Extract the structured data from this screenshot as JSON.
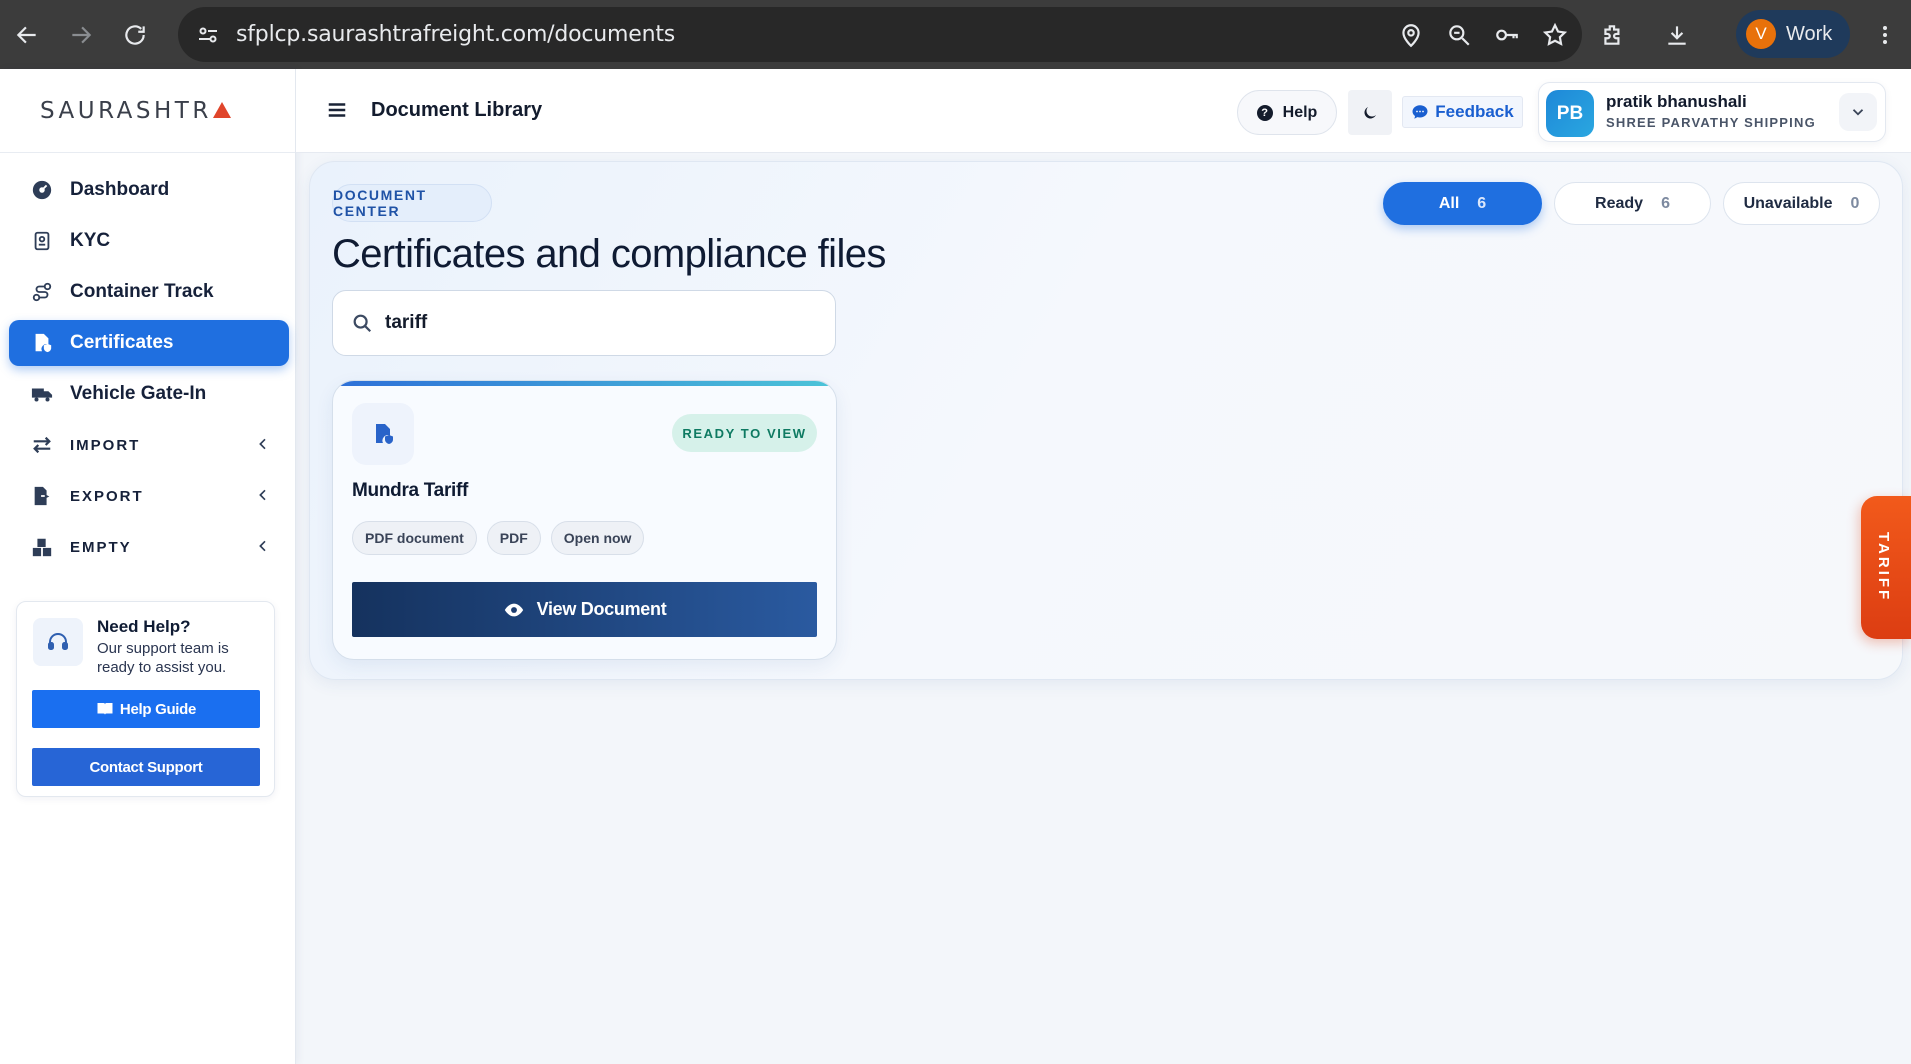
{
  "browser": {
    "url": "sfplcp.saurashtrafreight.com/documents",
    "profile_initial": "V",
    "profile_label": "Work"
  },
  "sidebar": {
    "brand": "SAURASHTR",
    "items": [
      {
        "label": "Dashboard",
        "icon": "dashboard-icon"
      },
      {
        "label": "KYC",
        "icon": "kyc-icon"
      },
      {
        "label": "Container Track",
        "icon": "route-icon"
      },
      {
        "label": "Certificates",
        "icon": "certificate-icon",
        "active": true
      },
      {
        "label": "Vehicle Gate-In",
        "icon": "truck-icon"
      }
    ],
    "sections": [
      {
        "label": "IMPORT",
        "icon": "swap-icon"
      },
      {
        "label": "EXPORT",
        "icon": "export-icon"
      },
      {
        "label": "EMPTY",
        "icon": "boxes-icon"
      }
    ],
    "help": {
      "title": "Need Help?",
      "subtitle": "Our support team is ready to assist you.",
      "guide_label": "Help Guide",
      "support_label": "Contact Support"
    }
  },
  "header": {
    "title": "Document Library",
    "help_label": "Help",
    "feedback_label": "Feedback",
    "user": {
      "initials": "PB",
      "name": "pratik bhanushali",
      "company": "SHREE PARVATHY SHIPPING"
    }
  },
  "main": {
    "eyebrow": "DOCUMENT CENTER",
    "heading": "Certificates and compliance files",
    "search_value": "tariff",
    "filters": [
      {
        "label": "All",
        "count": "6",
        "active": true
      },
      {
        "label": "Ready",
        "count": "6"
      },
      {
        "label": "Unavailable",
        "count": "0"
      }
    ],
    "card": {
      "status": "READY TO VIEW",
      "title": "Mundra Tariff",
      "tags": [
        "PDF document",
        "PDF",
        "Open now"
      ],
      "action_label": "View Document"
    },
    "side_tab": "TARIFF"
  },
  "colors": {
    "accent": "#1f6fe0",
    "brand_triangle": "#e0452b",
    "ready_badge": "#0e7a62",
    "tariff_tab": "#f25a1b",
    "view_button": "#15325e"
  }
}
